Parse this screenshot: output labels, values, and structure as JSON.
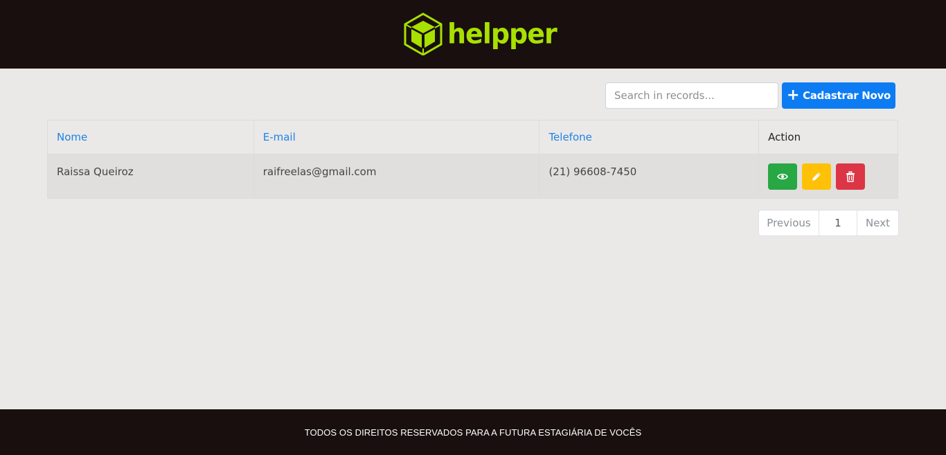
{
  "header": {
    "brand": "helpper",
    "logo_icon": "cube-hexagon-icon",
    "brand_color": "#a8e000"
  },
  "toolbar": {
    "search_placeholder": "Search in records...",
    "new_label": "Cadastrar Novo",
    "new_icon": "plus-icon",
    "accent": "#0d7cf2"
  },
  "table": {
    "columns": [
      "Nome",
      "E-mail",
      "Telefone",
      "Action"
    ],
    "rows": [
      {
        "nome": "Raissa Queiroz",
        "email": "raifreelas@gmail.com",
        "telefone": "(21) 96608-7450",
        "actions": [
          "eye-icon",
          "pencil-icon",
          "trash-icon"
        ]
      }
    ]
  },
  "pagination": {
    "previous": "Previous",
    "page": "1",
    "next": "Next"
  },
  "footer": {
    "text": "TODOS OS DIREITOS RESERVADOS PARA A FUTURA ESTAGIÁRIA DE VOCÊS"
  }
}
